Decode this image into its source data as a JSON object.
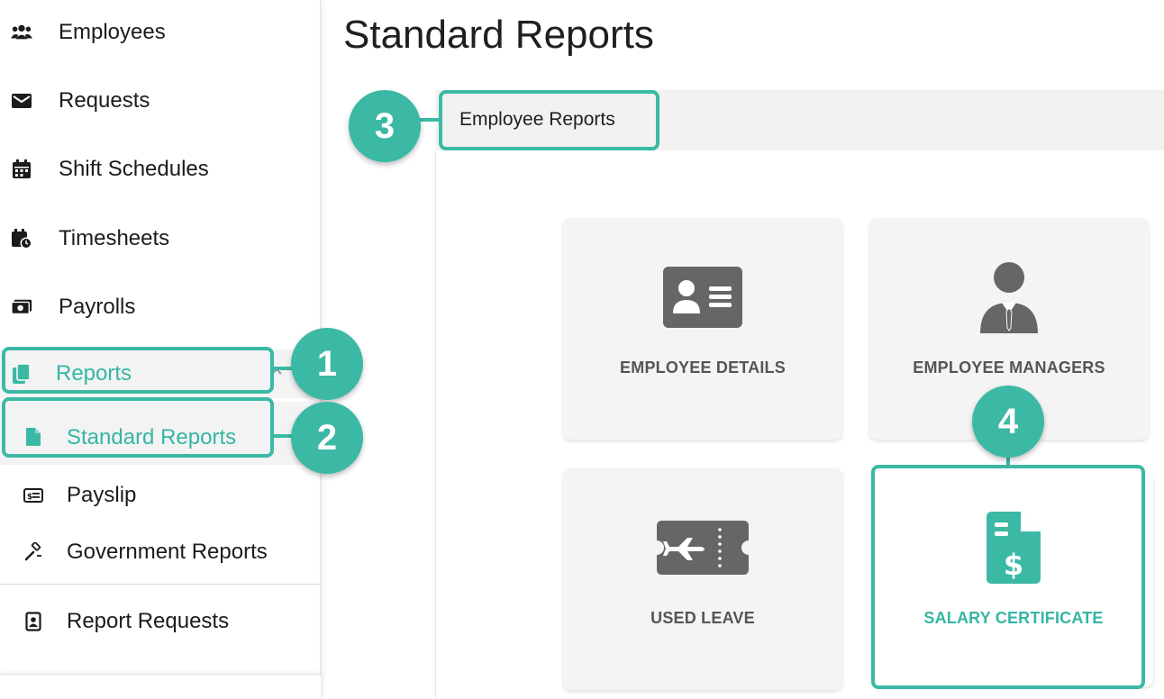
{
  "sidebar": {
    "items": [
      {
        "label": "Employees",
        "icon": "users-icon"
      },
      {
        "label": "Requests",
        "icon": "envelope-icon"
      },
      {
        "label": "Shift Schedules",
        "icon": "calendar-icon"
      },
      {
        "label": "Timesheets",
        "icon": "calendar-clock-icon"
      },
      {
        "label": "Payrolls",
        "icon": "money-icon"
      },
      {
        "label": "Reports",
        "icon": "copy-icon"
      }
    ],
    "sub_items": [
      {
        "label": "Standard Reports",
        "icon": "file-icon"
      },
      {
        "label": "Payslip",
        "icon": "payslip-icon"
      },
      {
        "label": "Government Reports",
        "icon": "gavel-icon"
      }
    ],
    "report_requests": {
      "label": "Report Requests",
      "icon": "file-user-icon"
    }
  },
  "main": {
    "title": "Standard Reports",
    "tab": "Employee Reports",
    "cards": [
      {
        "label": "EMPLOYEE DETAILS",
        "icon": "id-card-icon"
      },
      {
        "label": "EMPLOYEE MANAGERS",
        "icon": "manager-icon"
      },
      {
        "label": "USED LEAVE",
        "icon": "plane-ticket-icon"
      },
      {
        "label": "SALARY CERTIFICATE",
        "icon": "invoice-dollar-icon"
      }
    ]
  },
  "callouts": [
    "1",
    "2",
    "3",
    "4"
  ],
  "colors": {
    "accent": "#3bb9a5",
    "accent_text": "#35b6a4",
    "card_bg": "#f4f4f4",
    "icon_gray": "#666666"
  }
}
